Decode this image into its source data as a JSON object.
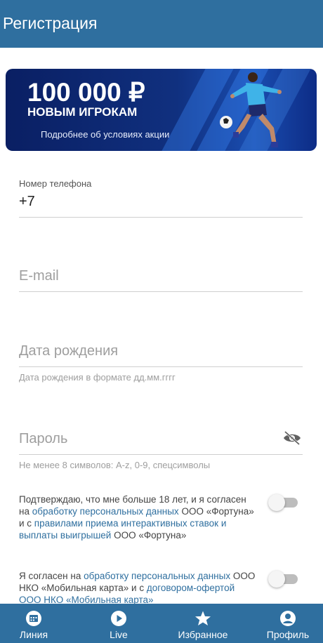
{
  "header": {
    "title": "Регистрация"
  },
  "banner": {
    "amount": "100 000 ₽",
    "subtitle": "НОВЫМ ИГРОКАМ",
    "link": "Подробнее об условиях акции"
  },
  "form": {
    "phone": {
      "label": "Номер телефона",
      "value": "+7"
    },
    "email": {
      "placeholder": "E-mail"
    },
    "birthdate": {
      "placeholder": "Дата рождения",
      "hint": "Дата рождения в формате дд.мм.гггг"
    },
    "password": {
      "placeholder": "Пароль",
      "hint": "Не менее 8 символов: A-z, 0-9, спецсимволы"
    }
  },
  "agreements": [
    {
      "text_1": "Подтверждаю, что мне больше 18 лет, и я согласен на ",
      "link_1": "обработку персональных данных",
      "text_2": " ООО «Фортуна» и с ",
      "link_2": "правилами приема интерактивных ставок и выплаты выигрышей",
      "text_3": " ООО «Фортуна»",
      "checked": false
    },
    {
      "text_1": "Я согласен на ",
      "link_1": "обработку персональных данных",
      "text_2": " ООО НКО «Мобильная карта» и с ",
      "link_2": "договором-офертой ООО НКО «Мобильная карта»",
      "checked": false
    }
  ],
  "bottom_nav": [
    {
      "label": "Линия",
      "icon": "calendar-icon"
    },
    {
      "label": "Live",
      "icon": "play-icon"
    },
    {
      "label": "Избранное",
      "icon": "star-icon"
    },
    {
      "label": "Профиль",
      "icon": "profile-icon"
    }
  ],
  "colors": {
    "primary": "#2f6f9f",
    "link": "#2f6f9f",
    "banner_bg": "#0a1f63"
  }
}
